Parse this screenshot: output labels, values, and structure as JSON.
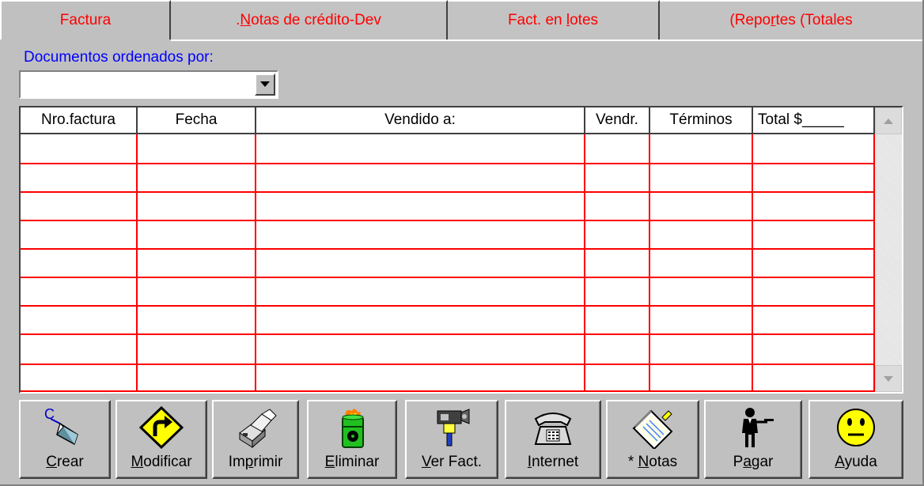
{
  "tabs": [
    {
      "label": "Factura",
      "active": true
    },
    {
      "label_pre": ".",
      "label_u": "N",
      "label_post": "otas de crédito-Dev"
    },
    {
      "label_pre": "Fact. en ",
      "label_u": "l",
      "label_post": "otes"
    },
    {
      "label_pre": "(Repo",
      "label_u": "r",
      "label_post": "tes  (Totales"
    }
  ],
  "sort": {
    "label": "Documentos ordenados por:",
    "value": ""
  },
  "grid": {
    "columns": [
      "Nro.factura",
      "Fecha",
      "Vendido a:",
      "Vendr.",
      "Términos",
      "Total  $_____"
    ],
    "rows": [],
    "line_color": "#ff0000"
  },
  "buttons": [
    {
      "pre": "",
      "u": "C",
      "post": "rear",
      "icon": "pen-icon"
    },
    {
      "pre": "",
      "u": "M",
      "post": "odificar",
      "icon": "turn-sign-icon"
    },
    {
      "pre": "Im",
      "u": "p",
      "post": "rimir",
      "icon": "printer-icon"
    },
    {
      "pre": "",
      "u": "E",
      "post": "liminar",
      "icon": "burning-barrel-icon"
    },
    {
      "pre": "",
      "u": "V",
      "post": "er Fact.",
      "icon": "camera-icon"
    },
    {
      "pre": "",
      "u": "I",
      "post": "nternet",
      "icon": "telephone-icon"
    },
    {
      "pre": "* ",
      "u": "N",
      "post": "otas",
      "icon": "notepad-icon"
    },
    {
      "pre": "P",
      "u": "a",
      "post": "gar",
      "icon": "waiter-icon"
    },
    {
      "pre": "",
      "u": "A",
      "post": "yuda",
      "icon": "smiley-icon"
    }
  ],
  "colors": {
    "tab_text": "#ff0000",
    "label_blue": "#0000ff",
    "face": "#c0c0c0"
  }
}
